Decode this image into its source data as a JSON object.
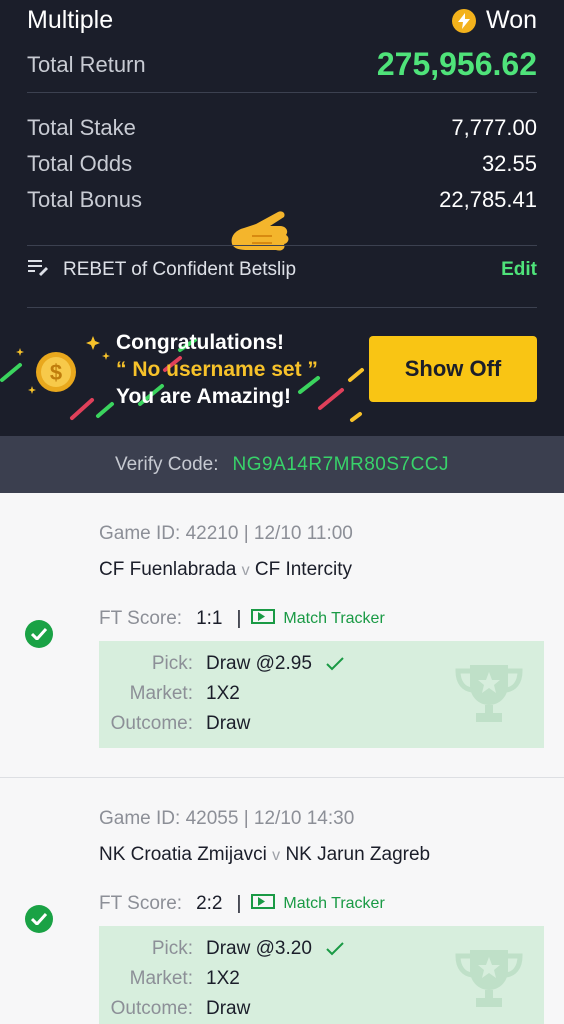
{
  "summary": {
    "bet_type": "Multiple",
    "status": "Won",
    "total_return_label": "Total Return",
    "total_return": "275,956.62",
    "stats": [
      {
        "label": "Total Stake",
        "value": "7,777.00"
      },
      {
        "label": "Total Odds",
        "value": "32.55"
      },
      {
        "label": "Total Bonus",
        "value": "22,785.41"
      }
    ],
    "rebet_label": "REBET of Confident Betslip",
    "edit_label": "Edit"
  },
  "banner": {
    "line1": "Congratulations!",
    "line2": "“ No username set ”",
    "line3": "You are Amazing!",
    "button": "Show Off"
  },
  "verify": {
    "label": "Verify Code:",
    "code": "NG9A14R7MR80S7CCJ"
  },
  "games": [
    {
      "game_id": "Game ID: 42210 | 12/10 11:00",
      "home": "CF Fuenlabrada",
      "vs": "v",
      "away": "CF Intercity",
      "ft_label": "FT Score:",
      "score": "1:1",
      "sep": "|",
      "tracker": "Match Tracker",
      "pick_label": "Pick:",
      "pick": "Draw @2.95",
      "market_label": "Market:",
      "market": "1X2",
      "outcome_label": "Outcome:",
      "outcome": "Draw"
    },
    {
      "game_id": "Game ID: 42055 | 12/10 14:30",
      "home": "NK Croatia Zmijavci",
      "vs": "v",
      "away": "NK Jarun Zagreb",
      "ft_label": "FT Score:",
      "score": "2:2",
      "sep": "|",
      "tracker": "Match Tracker",
      "pick_label": "Pick:",
      "pick": "Draw @3.20",
      "market_label": "Market:",
      "market": "1X2",
      "outcome_label": "Outcome:",
      "outcome": "Draw"
    }
  ],
  "colors": {
    "header_bg": "#1b1e2a",
    "accent_green": "#4fe37a",
    "button_yellow": "#f9c514",
    "win_green": "#1aa245",
    "pick_bg": "#d7eedd"
  },
  "icons": [
    "lightning-icon",
    "pointing-hand-icon",
    "list-edit-icon",
    "coin-icon",
    "check-icon",
    "tracker-icon",
    "trophy-icon"
  ]
}
